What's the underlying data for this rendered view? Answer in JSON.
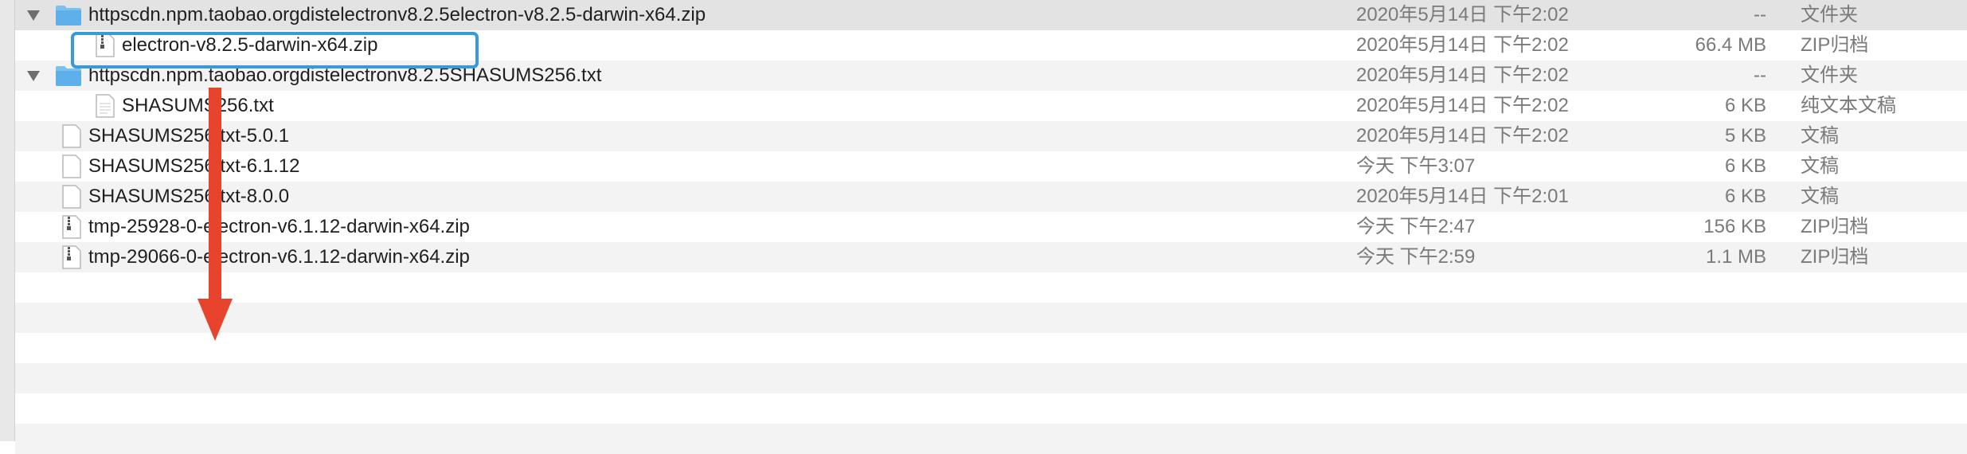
{
  "rows": [
    {
      "name": "httpscdn.npm.taobao.orgdistelectronv8.2.5electron-v8.2.5-darwin-x64.zip",
      "date": "2020年5月14日 下午2:02",
      "size": "--",
      "kind": "文件夹"
    },
    {
      "name": "electron-v8.2.5-darwin-x64.zip",
      "date": "2020年5月14日 下午2:02",
      "size": "66.4 MB",
      "kind": "ZIP归档"
    },
    {
      "name": "httpscdn.npm.taobao.orgdistelectronv8.2.5SHASUMS256.txt",
      "date": "2020年5月14日 下午2:02",
      "size": "--",
      "kind": "文件夹"
    },
    {
      "name": "SHASUMS256.txt",
      "date": "2020年5月14日 下午2:02",
      "size": "6 KB",
      "kind": "纯文本文稿"
    },
    {
      "name": "SHASUMS256.txt-5.0.1",
      "date": "2020年5月14日 下午2:02",
      "size": "5 KB",
      "kind": "文稿"
    },
    {
      "name": "SHASUMS256.txt-6.1.12",
      "date": "今天 下午3:07",
      "size": "6 KB",
      "kind": "文稿"
    },
    {
      "name": "SHASUMS256.txt-8.0.0",
      "date": "2020年5月14日 下午2:01",
      "size": "6 KB",
      "kind": "文稿"
    },
    {
      "name": "tmp-25928-0-electron-v6.1.12-darwin-x64.zip",
      "date": "今天 下午2:47",
      "size": "156 KB",
      "kind": "ZIP归档"
    },
    {
      "name": "tmp-29066-0-electron-v6.1.12-darwin-x64.zip",
      "date": "今天 下午2:59",
      "size": "1.1 MB",
      "kind": "ZIP归档"
    }
  ],
  "colors": {
    "highlight_box": "#3a9ad9",
    "arrow": "#e8432d",
    "folder_icon": "#7cc0ee"
  }
}
